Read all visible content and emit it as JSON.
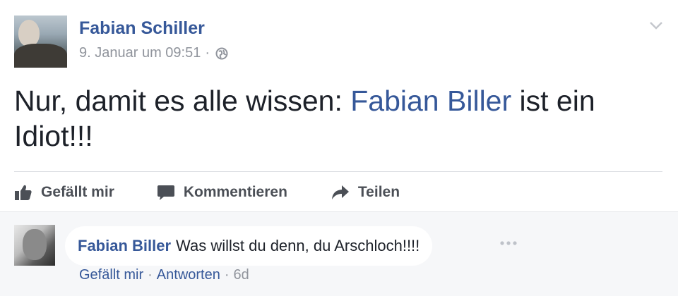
{
  "post": {
    "author": "Fabian Schiller",
    "date": "9. Januar um 09:51",
    "meta_separator": "·",
    "text_before": "Nur, damit es alle wissen: ",
    "mention": "Fabian Biller",
    "text_after": " ist ein Idiot!!!",
    "privacy_icon": "globe-icon",
    "menu_icon": "chevron-down-icon"
  },
  "actions": {
    "like_label": "Gefällt mir",
    "comment_label": "Kommentieren",
    "share_label": "Teilen"
  },
  "comment": {
    "author": "Fabian Biller",
    "text": "Was willst du denn, du Arschloch!!!!",
    "like_label": "Gefällt mir",
    "reply_label": "Antworten",
    "separator": "·",
    "time": "6d"
  },
  "colors": {
    "link_blue": "#365899",
    "meta_gray": "#90949c",
    "text_dark": "#1d2129",
    "action_gray": "#4b4f56",
    "comment_bg": "#f6f7f9"
  }
}
